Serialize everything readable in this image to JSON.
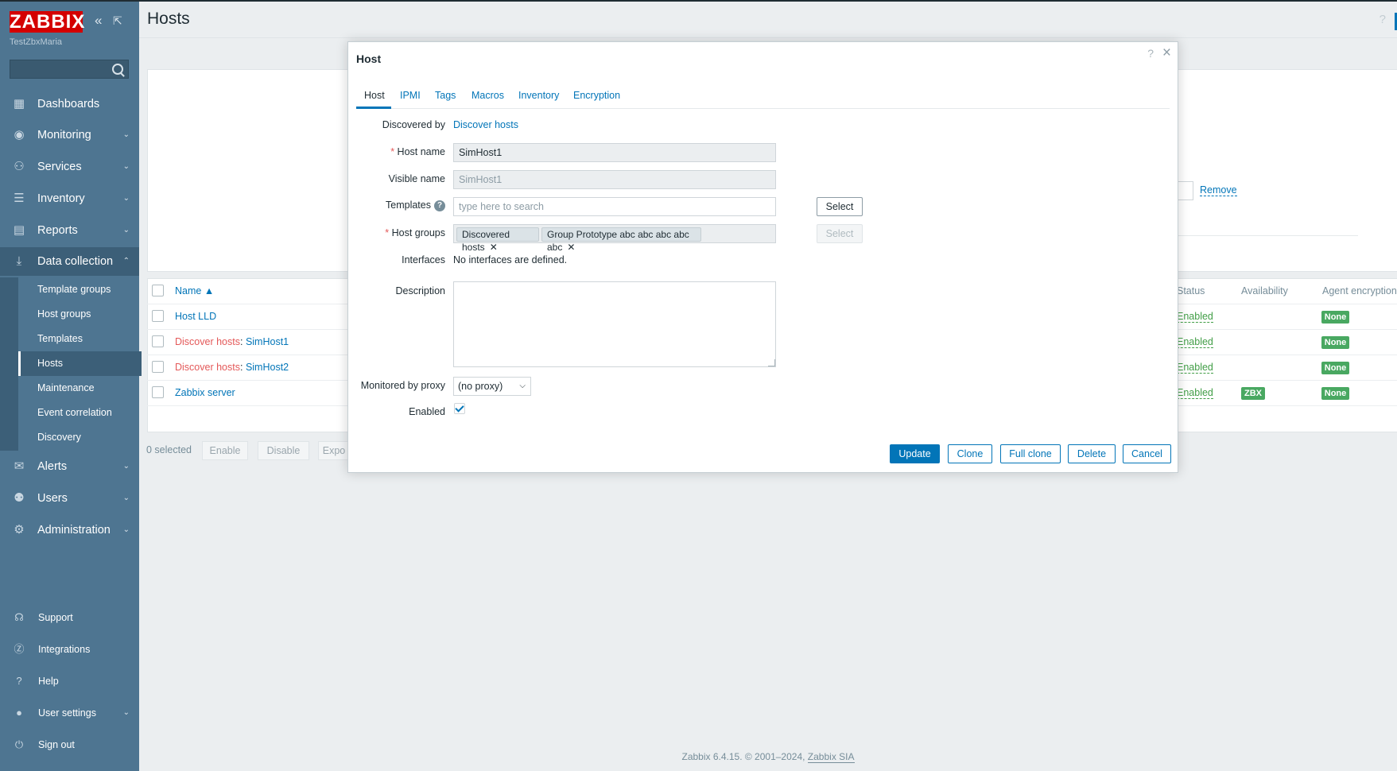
{
  "app": {
    "logo": "ZABBIX",
    "server_name": "TestZbxMaria",
    "search_placeholder": ""
  },
  "sidebar": {
    "menu": [
      {
        "label": "Dashboards",
        "icon": "dashboard-icon",
        "has_children": false
      },
      {
        "label": "Monitoring",
        "icon": "eye-icon",
        "has_children": true
      },
      {
        "label": "Services",
        "icon": "services-icon",
        "has_children": true
      },
      {
        "label": "Inventory",
        "icon": "list-icon",
        "has_children": true
      },
      {
        "label": "Reports",
        "icon": "reports-icon",
        "has_children": true
      },
      {
        "label": "Data collection",
        "icon": "download-icon",
        "has_children": true,
        "expanded": true
      },
      {
        "label": "Alerts",
        "icon": "mail-icon",
        "has_children": true
      },
      {
        "label": "Users",
        "icon": "users-icon",
        "has_children": true
      },
      {
        "label": "Administration",
        "icon": "gear-icon",
        "has_children": true
      }
    ],
    "submenu": [
      "Template groups",
      "Host groups",
      "Templates",
      "Hosts",
      "Maintenance",
      "Event correlation",
      "Discovery"
    ],
    "submenu_current": "Hosts",
    "bottom": [
      {
        "label": "Support",
        "icon": "headset-icon"
      },
      {
        "label": "Integrations",
        "icon": "integrations-icon"
      },
      {
        "label": "Help",
        "icon": "help-icon"
      },
      {
        "label": "User settings",
        "icon": "user-icon"
      },
      {
        "label": "Sign out",
        "icon": "power-icon"
      }
    ]
  },
  "header": {
    "title": "Hosts",
    "help": "?"
  },
  "filter": {
    "remove_label": "Remove"
  },
  "table": {
    "headers": {
      "name": "Name ▲",
      "status": "Status",
      "availability": "Availability",
      "agent_encryption": "Agent encryption"
    },
    "rows": [
      {
        "prefix": "",
        "name": "Host LLD",
        "status": "Enabled",
        "availability": "",
        "encryption": "None"
      },
      {
        "prefix": "Discover hosts",
        "name": "SimHost1",
        "status": "Enabled",
        "availability": "",
        "encryption": "None"
      },
      {
        "prefix": "Discover hosts",
        "name": "SimHost2",
        "status": "Enabled",
        "availability": "",
        "encryption": "None"
      },
      {
        "prefix": "",
        "name": "Zabbix server",
        "status": "Enabled",
        "availability": "ZBX",
        "encryption": "None"
      }
    ],
    "prefix_separator": ": "
  },
  "bottom_bar": {
    "selected": "0 selected",
    "enable": "Enable",
    "disable": "Disable",
    "export": "Expo"
  },
  "footer": {
    "text": "Zabbix 6.4.15. © 2001–2024, ",
    "link": "Zabbix SIA"
  },
  "modal": {
    "title": "Host",
    "help": "?",
    "close": "×",
    "tabs": [
      "Host",
      "IPMI",
      "Tags",
      "Macros",
      "Inventory",
      "Encryption"
    ],
    "active_tab": "Host",
    "fields": {
      "discovered_by_label": "Discovered by",
      "discovered_by_value": "Discover hosts",
      "host_name_label": "Host name",
      "host_name_value": "SimHost1",
      "visible_name_label": "Visible name",
      "visible_name_value": "SimHost1",
      "templates_label": "Templates",
      "templates_placeholder": "type here to search",
      "templates_select": "Select",
      "host_groups_label": "Host groups",
      "host_groups": [
        "Discovered hosts",
        "Group Prototype abc abc abc abc abc"
      ],
      "host_groups_select": "Select",
      "interfaces_label": "Interfaces",
      "interfaces_value": "No interfaces are defined.",
      "description_label": "Description",
      "description_value": "",
      "proxy_label": "Monitored by proxy",
      "proxy_value": "(no proxy)",
      "enabled_label": "Enabled",
      "enabled_checked": true
    },
    "buttons": {
      "update": "Update",
      "clone": "Clone",
      "full_clone": "Full clone",
      "delete": "Delete",
      "cancel": "Cancel"
    }
  }
}
